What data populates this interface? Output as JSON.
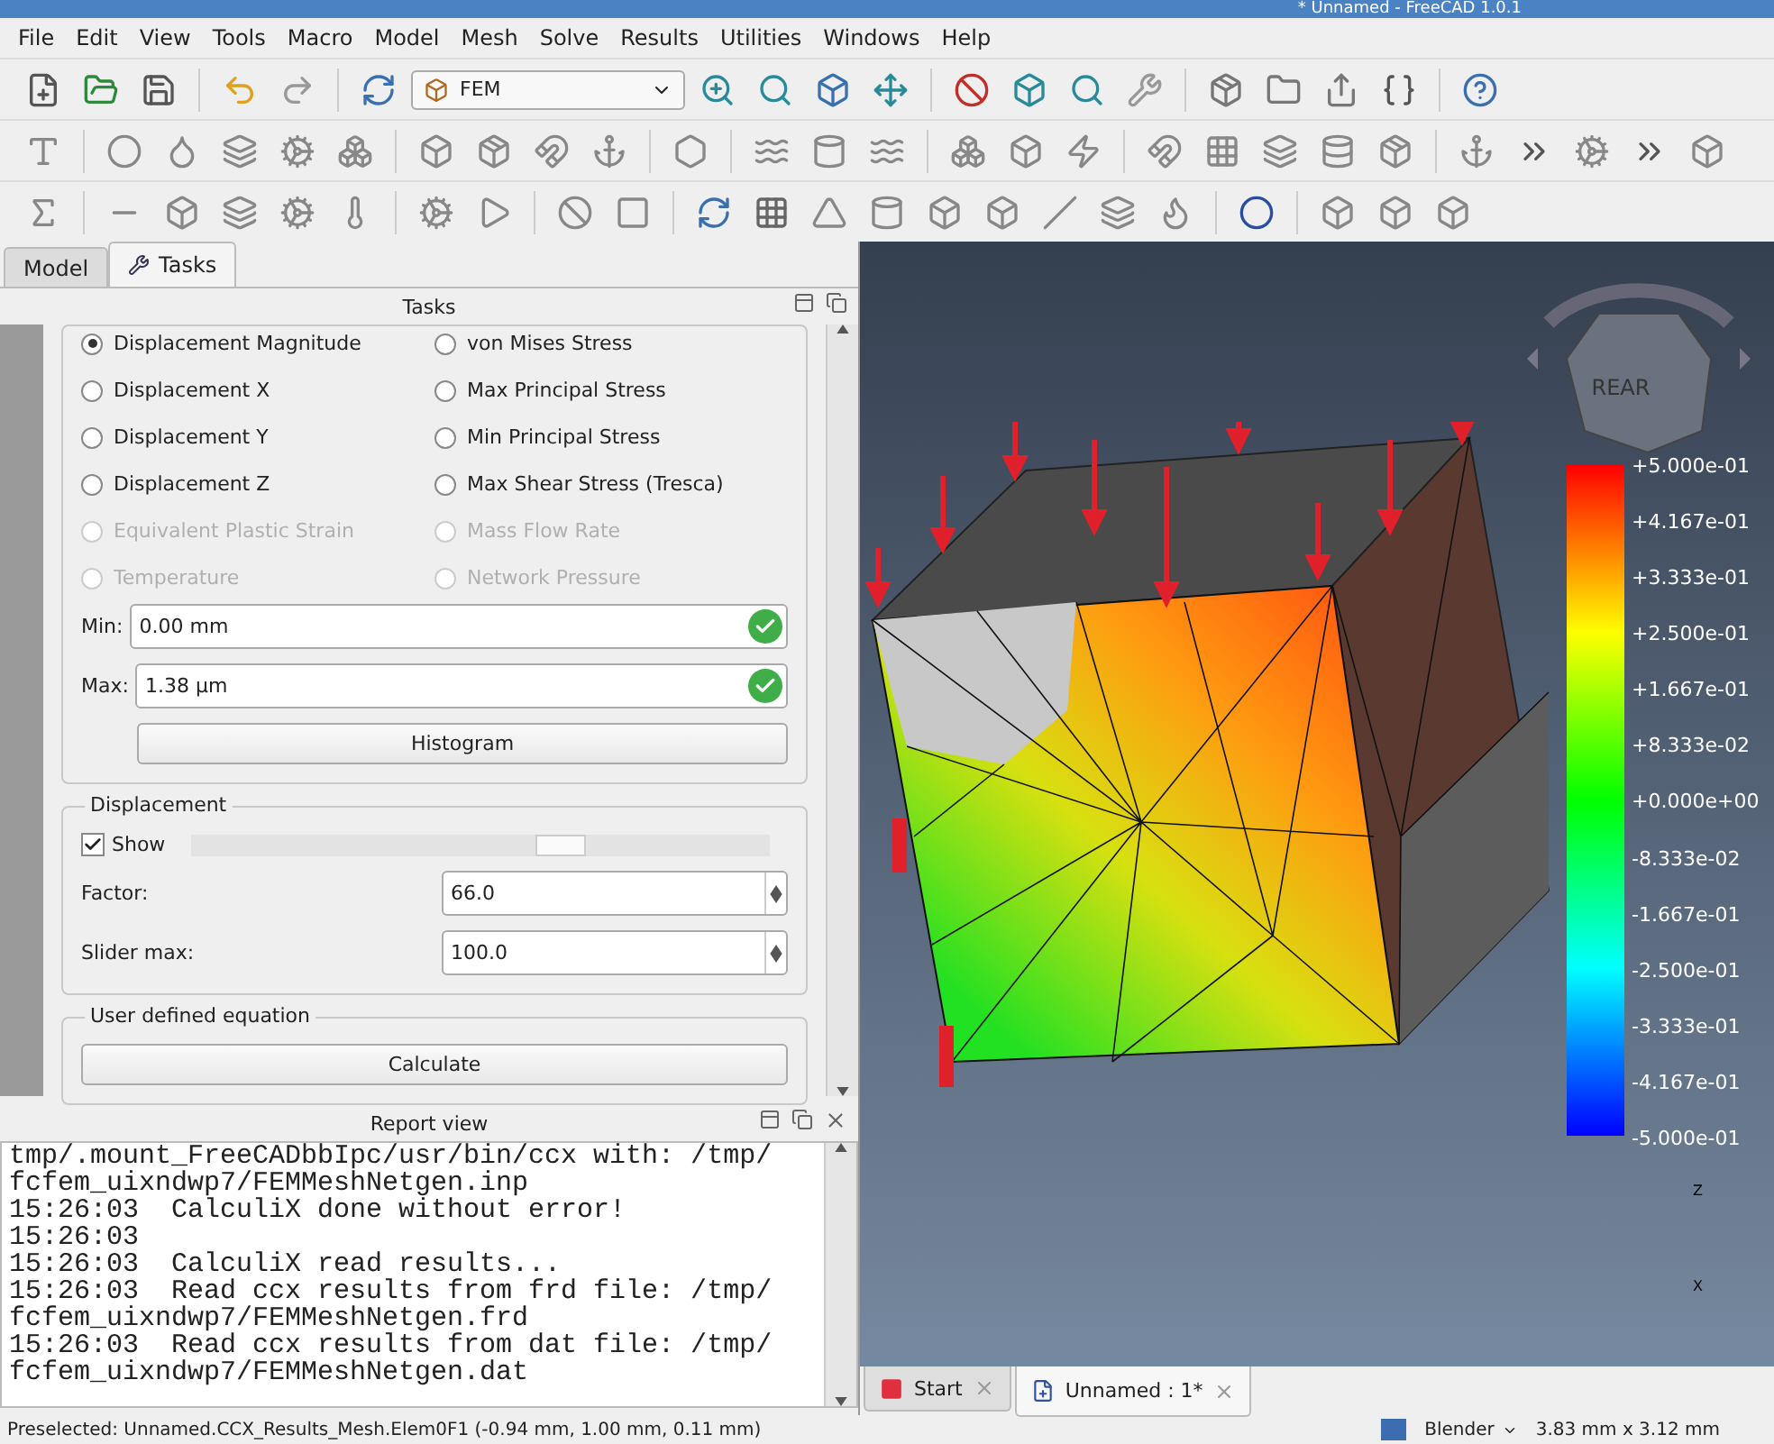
{
  "window": {
    "title": "* Unnamed - FreeCAD 1.0.1"
  },
  "menu": [
    "File",
    "Edit",
    "View",
    "Tools",
    "Macro",
    "Model",
    "Mesh",
    "Solve",
    "Results",
    "Utilities",
    "Windows",
    "Help"
  ],
  "workbench_selector": {
    "value": "FEM"
  },
  "panel_tabs": [
    {
      "label": "Model",
      "selected": false
    },
    {
      "label": "Tasks",
      "selected": true
    }
  ],
  "tasks": {
    "title": "Tasks",
    "result_types": [
      {
        "label": "Displacement Magnitude",
        "selected": true,
        "disabled": false
      },
      {
        "label": "von Mises Stress",
        "selected": false,
        "disabled": false
      },
      {
        "label": "Displacement X",
        "selected": false,
        "disabled": false
      },
      {
        "label": "Max Principal Stress",
        "selected": false,
        "disabled": false
      },
      {
        "label": "Displacement Y",
        "selected": false,
        "disabled": false
      },
      {
        "label": "Min Principal Stress",
        "selected": false,
        "disabled": false
      },
      {
        "label": "Displacement Z",
        "selected": false,
        "disabled": false
      },
      {
        "label": "Max Shear Stress (Tresca)",
        "selected": false,
        "disabled": false
      },
      {
        "label": "Equivalent Plastic Strain",
        "selected": false,
        "disabled": true
      },
      {
        "label": "Mass Flow Rate",
        "selected": false,
        "disabled": true
      },
      {
        "label": "Temperature",
        "selected": false,
        "disabled": true
      },
      {
        "label": "Network Pressure",
        "selected": false,
        "disabled": true
      }
    ],
    "min": {
      "label": "Min:",
      "value": "0.00 mm"
    },
    "max": {
      "label": "Max:",
      "value": "1.38 μm"
    },
    "histogram_button": "Histogram",
    "displacement": {
      "title": "Displacement",
      "show": {
        "label": "Show",
        "checked": true
      },
      "slider": {
        "level": 0.64
      },
      "factor": {
        "label": "Factor:",
        "value": "66.0"
      },
      "slider_max": {
        "label": "Slider max:",
        "value": "100.0"
      }
    },
    "user_equation": {
      "title": "User defined equation",
      "button": "Calculate"
    }
  },
  "report_view": {
    "title": "Report view",
    "lines": [
      "tmp/.mount_FreeCADbbIpc/usr/bin/ccx with: /tmp/",
      "fcfem_uixndwp7/FEMMeshNetgen.inp",
      "15:26:03  CalculiX done without error!",
      "15:26:03",
      "15:26:03  CalculiX read results...",
      "15:26:03  Read ccx results from frd file: /tmp/",
      "fcfem_uixndwp7/FEMMeshNetgen.frd",
      "15:26:03  Read ccx results from dat file: /tmp/",
      "fcfem_uixndwp7/FEMMeshNetgen.dat"
    ]
  },
  "viewport": {
    "navcube_face": "REAR",
    "legend": {
      "labels": [
        "+5.000e-01",
        "+4.167e-01",
        "+3.333e-01",
        "+2.500e-01",
        "+1.667e-01",
        "+8.333e-02",
        "+0.000e+00",
        "-8.333e-02",
        "-1.667e-01",
        "-2.500e-01",
        "-3.333e-01",
        "-4.167e-01",
        "-5.000e-01"
      ]
    },
    "axes": [
      "Z",
      "X"
    ]
  },
  "document_tabs": [
    {
      "label": "Start",
      "selected": false
    },
    {
      "label": "Unnamed : 1*",
      "selected": true
    }
  ],
  "status_bar": {
    "message": "Preselected: Unnamed.CCX_Results_Mesh.Elem0F1 (-0.94 mm, 1.00 mm, 0.11 mm)",
    "navigation_style": "Blender",
    "dimensions": "3.83 mm x 3.12 mm"
  }
}
